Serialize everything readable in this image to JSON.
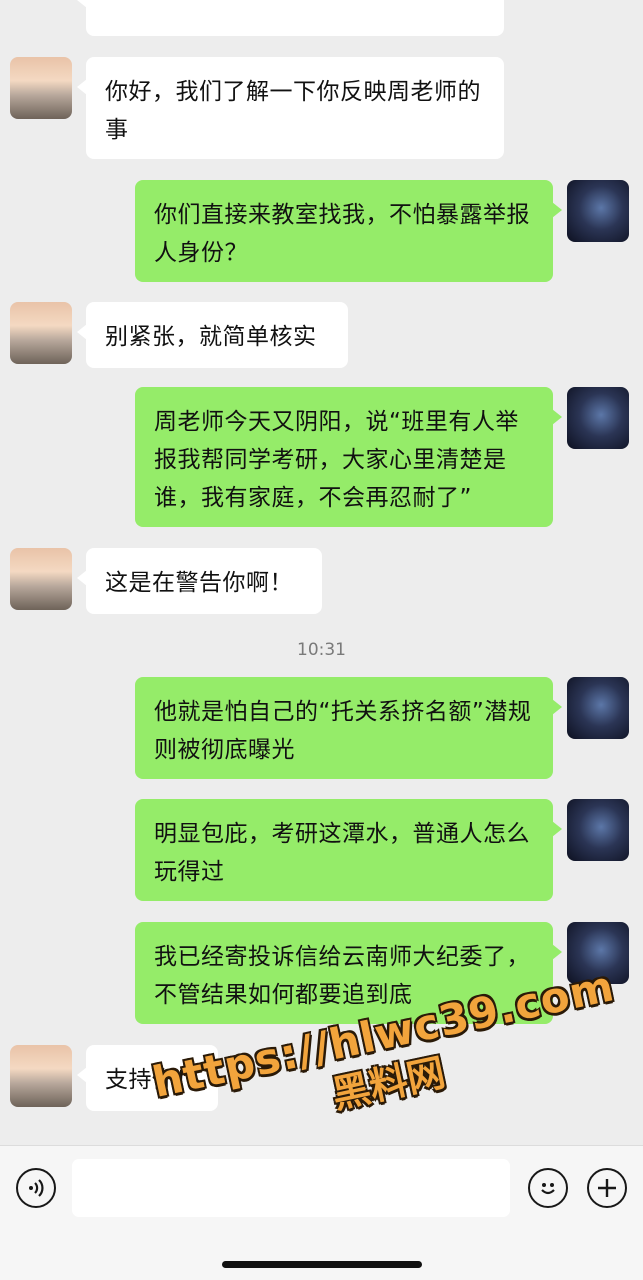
{
  "messages": [
    {
      "side": "in",
      "text": "你好，我们了解一下你反映周老师的事"
    },
    {
      "side": "out",
      "text": "你们直接来教室找我，不怕暴露举报人身份？"
    },
    {
      "side": "in",
      "text": "别紧张，就简单核实"
    },
    {
      "side": "out",
      "text": "周老师今天又阴阳，说“班里有人举报我帮同学考研，大家心里清楚是谁，我有家庭，不会再忍耐了”"
    },
    {
      "side": "in",
      "text": "这是在警告你啊！"
    },
    {
      "side": "out",
      "text": "他就是怕自己的“托关系挤名额”潜规则被彻底曝光"
    },
    {
      "side": "out",
      "text": "明显包庇，考研这潭水，普通人怎么玩得过"
    },
    {
      "side": "out",
      "text": "我已经寄投诉信给云南师大纪委了，不管结果如何都要追到底"
    },
    {
      "side": "in",
      "text": "支持你！"
    }
  ],
  "timestamp": "10:31",
  "input": {
    "value": ""
  },
  "watermark": {
    "url": "https://hlwc39.com",
    "site": "黑料网"
  },
  "icons": {
    "voice": "voice-icon",
    "emoji": "emoji-icon",
    "plus": "plus-icon"
  },
  "colors": {
    "background": "#ededed",
    "incoming_bubble": "#ffffff",
    "outgoing_bubble": "#95ec69",
    "watermark": "#f2a43c"
  }
}
